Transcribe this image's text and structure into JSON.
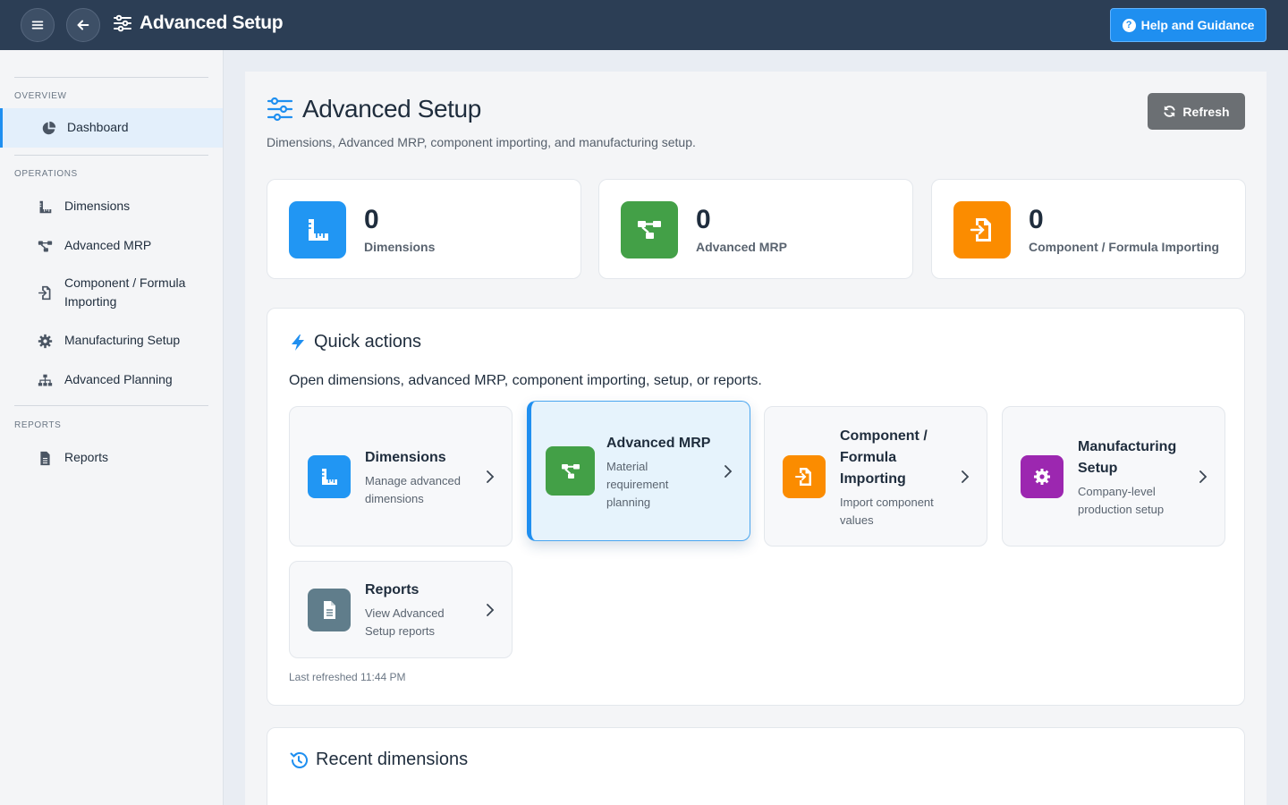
{
  "topbar": {
    "title": "Advanced Setup",
    "help_label": "Help and Guidance"
  },
  "sidebar": {
    "sections": [
      {
        "label": "OVERVIEW"
      },
      {
        "label": "OPERATIONS"
      },
      {
        "label": "REPORTS"
      }
    ],
    "items": [
      {
        "label": "Dashboard",
        "icon": "chart-pie-icon",
        "active": true
      },
      {
        "label": "Dimensions",
        "icon": "ruler-icon"
      },
      {
        "label": "Advanced MRP",
        "icon": "project-diagram-icon"
      },
      {
        "label": "Component / Formula Importing",
        "icon": "file-import-icon"
      },
      {
        "label": "Manufacturing Setup",
        "icon": "gear-icon"
      },
      {
        "label": "Advanced Planning",
        "icon": "sitemap-icon"
      },
      {
        "label": "Reports",
        "icon": "file-icon"
      }
    ]
  },
  "page": {
    "title": "Advanced Setup",
    "subtitle": "Dimensions, Advanced MRP, component importing, and manufacturing setup.",
    "refresh_label": "Refresh"
  },
  "stats": [
    {
      "value": "0",
      "label": "Dimensions",
      "color": "#2196f3"
    },
    {
      "value": "0",
      "label": "Advanced MRP",
      "color": "#43a047"
    },
    {
      "value": "0",
      "label": "Component / Formula Importing",
      "color": "#fb8c00"
    }
  ],
  "quick_actions": {
    "title": "Quick actions",
    "subtitle": "Open dimensions, advanced MRP, component importing, setup, or reports.",
    "cards": [
      {
        "title": "Dimensions",
        "desc": "Manage advanced dimensions",
        "color": "#2196f3"
      },
      {
        "title": "Advanced MRP",
        "desc": "Material requirement planning",
        "color": "#43a047",
        "selected": true
      },
      {
        "title": "Component / Formula Importing",
        "desc": "Import component values",
        "color": "#fb8c00"
      },
      {
        "title": "Manufacturing Setup",
        "desc": "Company-level production setup",
        "color": "#9c27b0"
      },
      {
        "title": "Reports",
        "desc": "View Advanced Setup reports",
        "color": "#607d8b"
      }
    ],
    "last_refreshed": "Last refreshed 11:44 PM"
  },
  "recent": {
    "title": "Recent dimensions"
  },
  "colors": {
    "accent": "#1f8ff0",
    "topbar": "#2c3e55"
  }
}
